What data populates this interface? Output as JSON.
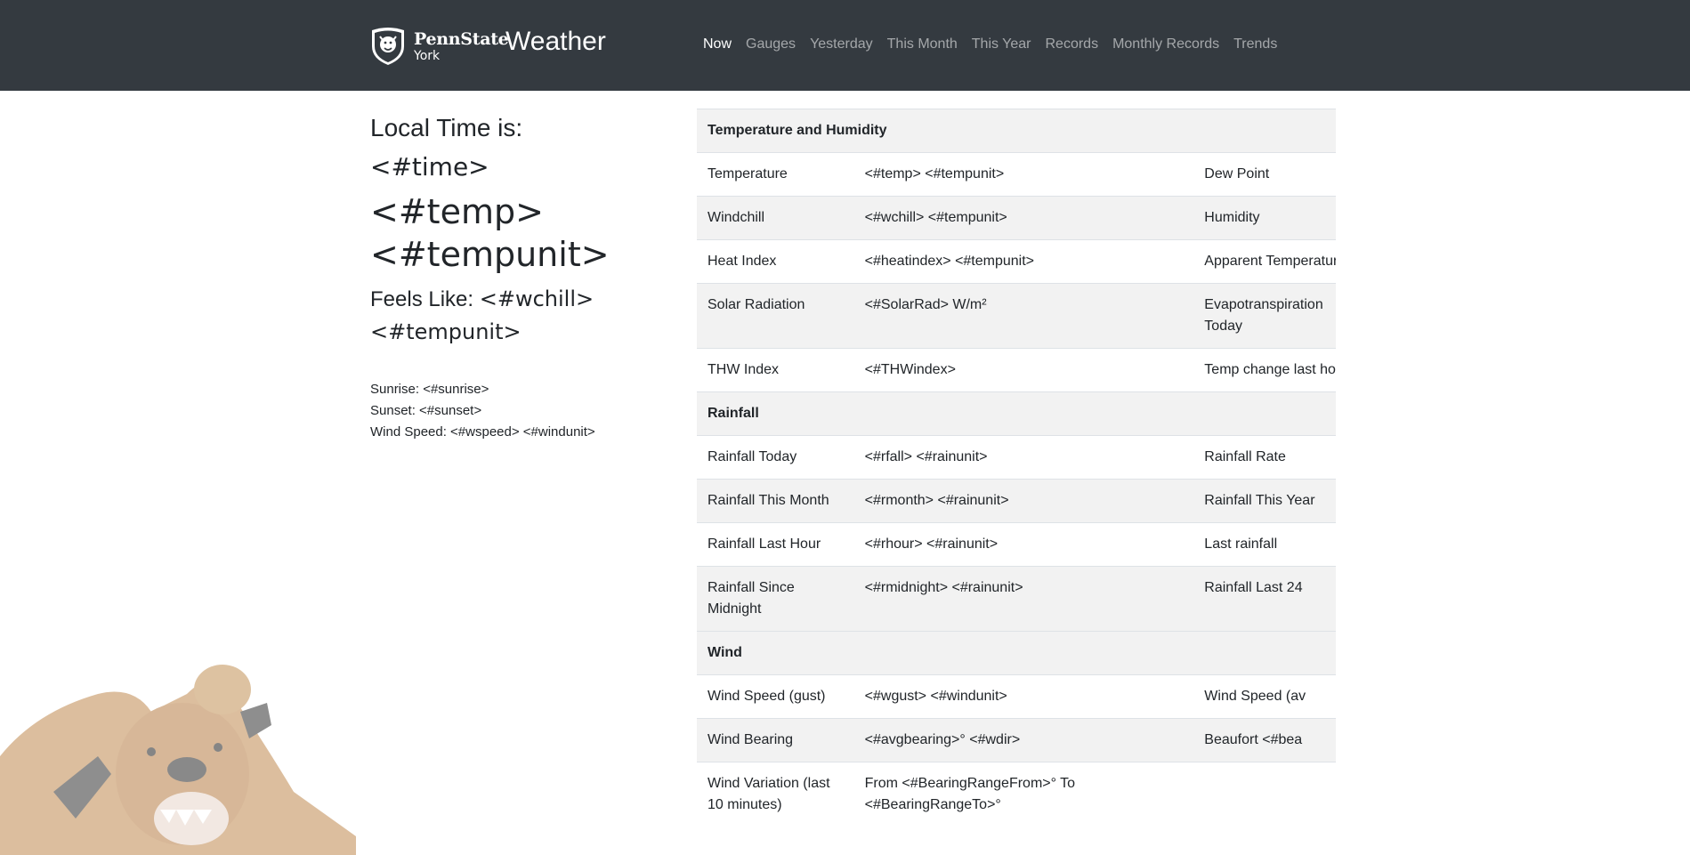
{
  "header": {
    "brand_name": "PennState",
    "brand_campus": "York",
    "app_title": "Weather",
    "nav": [
      "Now",
      "Gauges",
      "Yesterday",
      "This Month",
      "This Year",
      "Records",
      "Monthly Records",
      "Trends"
    ],
    "active_nav": "Now"
  },
  "current": {
    "local_time_label": "Local Time is:",
    "time": "<#time>",
    "temp": "<#temp>",
    "temp_unit": "<#tempunit>",
    "feels_like_label": "Feels Like:",
    "feels_like_value": "<#wchill>",
    "feels_like_unit": "<#tempunit>",
    "sunrise": "Sunrise: <#sunrise>",
    "sunset": "Sunset: <#sunset>",
    "wind_speed": "Wind Speed: <#wspeed> <#windunit>"
  },
  "table": {
    "rows": [
      {
        "type": "head",
        "label": "Temperature and Humidity"
      },
      {
        "label": "Temperature",
        "value": "<#temp> <#tempunit>",
        "label2": "Dew Point"
      },
      {
        "label": "Windchill",
        "value": "<#wchill> <#tempunit>",
        "label2": "Humidity"
      },
      {
        "label": "Heat Index",
        "value": "<#heatindex> <#tempunit>",
        "label2": "Apparent Temperature"
      },
      {
        "label": "Solar Radiation",
        "value": "<#SolarRad> W/m²",
        "label2": "Evapotranspiration Today"
      },
      {
        "label": "THW Index",
        "value": "<#THWindex>",
        "label2": "Temp change last hour"
      },
      {
        "type": "head",
        "label": "Rainfall"
      },
      {
        "label": "Rainfall Today",
        "value": "<#rfall> <#rainunit>",
        "label2": "Rainfall Rate"
      },
      {
        "label": "Rainfall This Month",
        "value": "<#rmonth> <#rainunit>",
        "label2": "Rainfall This Year"
      },
      {
        "label": "Rainfall Last Hour",
        "value": "<#rhour> <#rainunit>",
        "label2": "Last rainfall"
      },
      {
        "label": "Rainfall Since Midnight",
        "value": "<#rmidnight> <#rainunit>",
        "label2": "Rainfall Last 24"
      },
      {
        "type": "head",
        "label": "Wind"
      },
      {
        "label": "Wind Speed (gust)",
        "value": "<#wgust> <#windunit>",
        "label2": "Wind Speed (av"
      },
      {
        "label": "Wind Bearing",
        "value": "<#avgbearing>° <#wdir>",
        "label2": "Beaufort <#bea"
      },
      {
        "label": "Wind Variation (last 10 minutes)",
        "value": "From <#BearingRangeFrom>° To <#BearingRangeTo>°",
        "label2": ""
      }
    ]
  }
}
